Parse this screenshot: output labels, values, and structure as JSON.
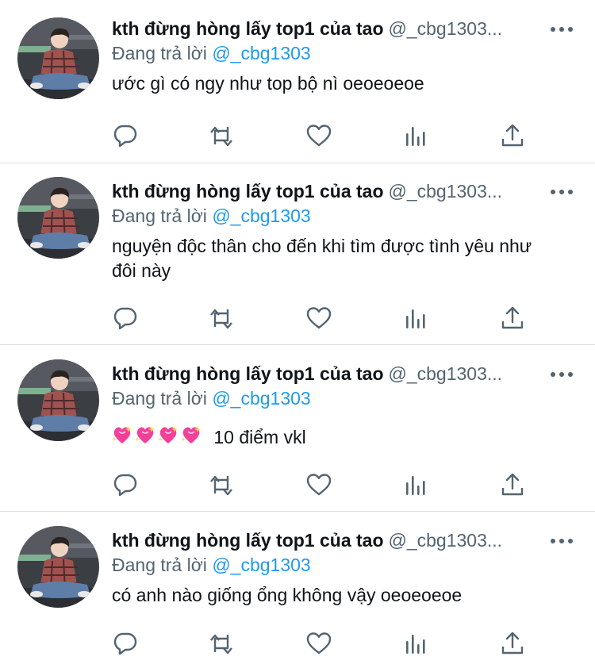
{
  "colors": {
    "name": "#0f1419",
    "secondary": "#536471",
    "mention": "#1d9bf0",
    "divider": "#d9dde1",
    "heart_emoji": "#f43f9a"
  },
  "icons": [
    "reply-icon",
    "retweet-icon",
    "like-icon",
    "views-icon",
    "share-icon",
    "more-icon",
    "sparkling-heart-icon"
  ],
  "tweets": [
    {
      "name": "kth đừng hòng lấy top1 của tao",
      "handle": "@_cbg1303...",
      "reply_prefix": "Đang trả lời",
      "reply_to": "@_cbg1303",
      "text": "ước gì có ngy như top bộ nì oeoeoeoe"
    },
    {
      "name": "kth đừng hòng lấy top1 của tao",
      "handle": "@_cbg1303...",
      "reply_prefix": "Đang trả lời",
      "reply_to": "@_cbg1303",
      "text": "nguyện độc thân cho đến khi tìm được tình yêu như đôi này"
    },
    {
      "name": "kth đừng hòng lấy top1 của tao",
      "handle": "@_cbg1303...",
      "reply_prefix": "Đang trả lời",
      "reply_to": "@_cbg1303",
      "emoji_count": 4,
      "text": "10 điểm vkl"
    },
    {
      "name": "kth đừng hòng lấy top1 của tao",
      "handle": "@_cbg1303...",
      "reply_prefix": "Đang trả lời",
      "reply_to": "@_cbg1303",
      "text": "có anh nào giống ổng không vậy oeoeoeoe"
    }
  ]
}
